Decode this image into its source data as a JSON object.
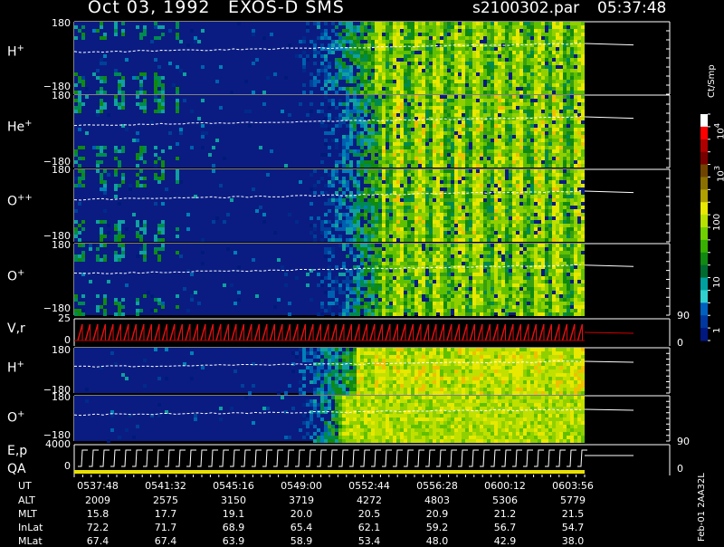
{
  "header": {
    "date": "Oct 03, 1992",
    "instrument": "EXOS-D SMS",
    "file": "s2100302.par",
    "time": "05:37:48"
  },
  "chart_data": [
    {
      "type": "heatmap",
      "panel": "H+",
      "label": "H",
      "sup": "+",
      "ylim": [
        -180,
        180
      ],
      "ticks": {
        "top": "180",
        "bottom": "−180"
      }
    },
    {
      "type": "heatmap",
      "panel": "He+",
      "label": "He",
      "sup": "+",
      "ylim": [
        -180,
        180
      ],
      "ticks": {
        "top": "180",
        "bottom": "−180"
      }
    },
    {
      "type": "heatmap",
      "panel": "O++",
      "label": "O",
      "sup": "++",
      "ylim": [
        -180,
        180
      ],
      "ticks": {
        "top": "180",
        "bottom": "−180"
      }
    },
    {
      "type": "heatmap",
      "panel": "O+",
      "label": "O",
      "sup": "+",
      "ylim": [
        -180,
        180
      ],
      "ticks": {
        "top": "180",
        "bottom": "−180"
      }
    },
    {
      "type": "line",
      "panel": "V,r",
      "label": "V,r",
      "ylim": [
        0,
        25
      ],
      "ticks": {
        "top": "25",
        "bottom": "0"
      },
      "right_ticks": {
        "top": "90",
        "bottom": "0"
      }
    },
    {
      "type": "heatmap",
      "panel": "H+ (2)",
      "label": "H",
      "sup": "+",
      "ylim": [
        -180,
        180
      ],
      "ticks": {
        "top": "180",
        "bottom": "−180"
      }
    },
    {
      "type": "heatmap",
      "panel": "O+ (2)",
      "label": "O",
      "sup": "+",
      "ylim": [
        -180,
        180
      ],
      "ticks": {
        "top": "180",
        "bottom": "−180"
      }
    },
    {
      "type": "line",
      "panel": "E,p QA",
      "label": "E,p",
      "label2": "QA",
      "ylim": [
        0,
        4000
      ],
      "ticks": {
        "top": "4000",
        "bottom": "0"
      },
      "right_ticks": {
        "top": "90",
        "bottom": "0"
      }
    }
  ],
  "colorbar": {
    "unit": "Ct/Smp",
    "labels": [
      "10",
      "100",
      "10",
      "10",
      "1"
    ],
    "label_exps": [
      "4",
      "",
      "3",
      "",
      ""
    ],
    "colors": [
      "#ffffff",
      "#ff0000",
      "#b00000",
      "#7a0000",
      "#704400",
      "#8a7000",
      "#b0a000",
      "#e8e800",
      "#b8e000",
      "#70d000",
      "#38b000",
      "#108a10",
      "#006a30",
      "#00a0a0",
      "#30d0d0",
      "#0060c0",
      "#0038a0",
      "#001880"
    ]
  },
  "table": {
    "rows": [
      {
        "label": "UT",
        "values": [
          "0537:48",
          "0541:32",
          "0545:16",
          "0549:00",
          "0552:44",
          "0556:28",
          "0600:12",
          "0603:56"
        ]
      },
      {
        "label": "ALT",
        "values": [
          "2009",
          "2575",
          "3150",
          "3719",
          "4272",
          "4803",
          "5306",
          "5779"
        ]
      },
      {
        "label": "MLT",
        "values": [
          "15.8",
          "17.7",
          "19.1",
          "20.0",
          "20.5",
          "20.9",
          "21.2",
          "21.5"
        ]
      },
      {
        "label": "InLat",
        "values": [
          "72.2",
          "71.7",
          "68.9",
          "65.4",
          "62.1",
          "59.2",
          "56.7",
          "54.7"
        ]
      },
      {
        "label": "MLat",
        "values": [
          "67.4",
          "67.4",
          "63.9",
          "58.9",
          "53.4",
          "48.0",
          "42.9",
          "38.0"
        ]
      }
    ]
  },
  "footnote": "Feb-01 2AA32L"
}
